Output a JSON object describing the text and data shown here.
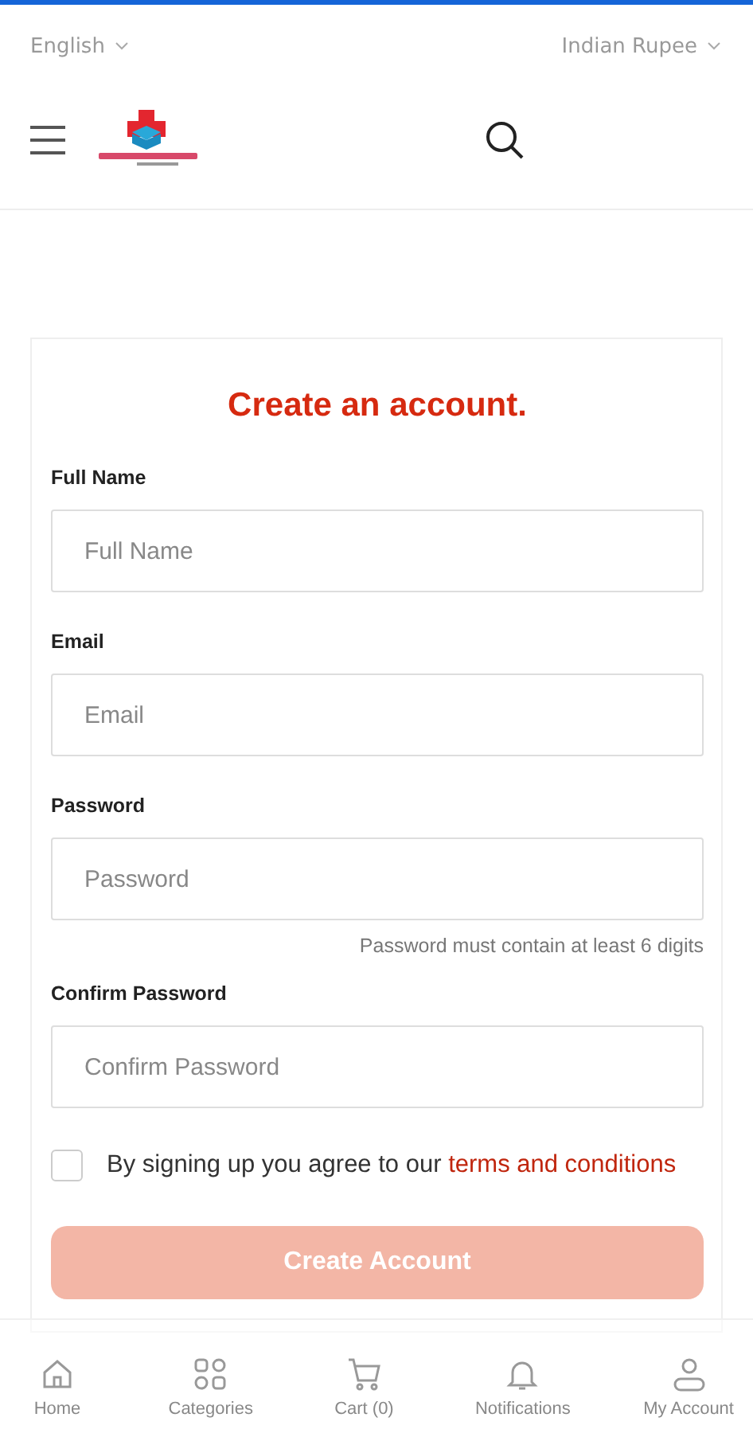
{
  "top_bar": {
    "language": "English",
    "currency": "Indian Rupee"
  },
  "form": {
    "title": "Create an account.",
    "fields": [
      {
        "label": "Full Name",
        "placeholder": "Full Name"
      },
      {
        "label": "Email",
        "placeholder": "Email"
      },
      {
        "label": "Password",
        "placeholder": "Password",
        "hint": "Password must contain at least 6 digits"
      },
      {
        "label": "Confirm Password",
        "placeholder": "Confirm Password"
      }
    ],
    "agree": {
      "checked": false,
      "text": "By signing up you agree to our ",
      "link": "terms and conditions"
    },
    "submit": "Create Account"
  },
  "bottom_nav": [
    {
      "label": "Home"
    },
    {
      "label": "Categories"
    },
    {
      "label": "Cart (0)"
    },
    {
      "label": "Notifications"
    },
    {
      "label": "My Account"
    }
  ]
}
